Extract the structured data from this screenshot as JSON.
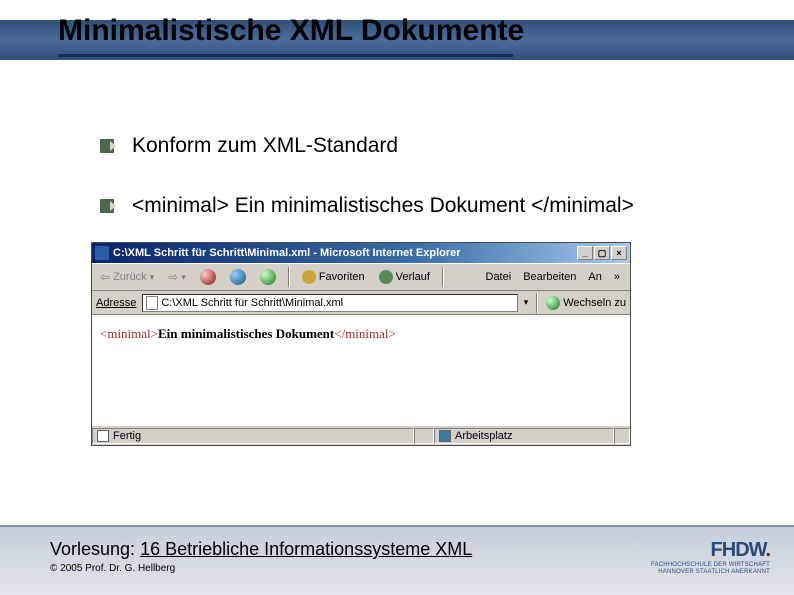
{
  "slide": {
    "title": "Minimalistische XML Dokumente",
    "bullets": [
      "Konform zum XML-Standard",
      "<minimal> Ein minimalistisches Dokument </minimal>"
    ]
  },
  "ie": {
    "titlebar": "C:\\XML Schritt für Schritt\\Minimal.xml - Microsoft Internet Explorer",
    "toolbar": {
      "back": "Zurück",
      "favorites": "Favoriten",
      "history": "Verlauf"
    },
    "menu": {
      "file": "Datei",
      "edit": "Bearbeiten",
      "view": "An",
      "more": "»"
    },
    "address_label": "Adresse",
    "address_value": "C:\\XML Schritt für Schritt\\Minimal.xml",
    "address_go": "Wechseln zu",
    "content_open": "<minimal>",
    "content_text": "Ein minimalistisches Dokument",
    "content_close": "</minimal>",
    "status_left": "Fertig",
    "status_right": "Arbeitsplatz"
  },
  "footer": {
    "lecture_label": "Vorlesung:",
    "lecture_title": "16 Betriebliche Informationssysteme XML",
    "copyright": "© 2005 Prof. Dr. G. Hellberg",
    "logo_main": "FHDW",
    "logo_sub1": "FACHHOCHSCHULE DER WIRTSCHAFT",
    "logo_sub2": "HANNOVER   STAATLICH ANERKANNT"
  }
}
